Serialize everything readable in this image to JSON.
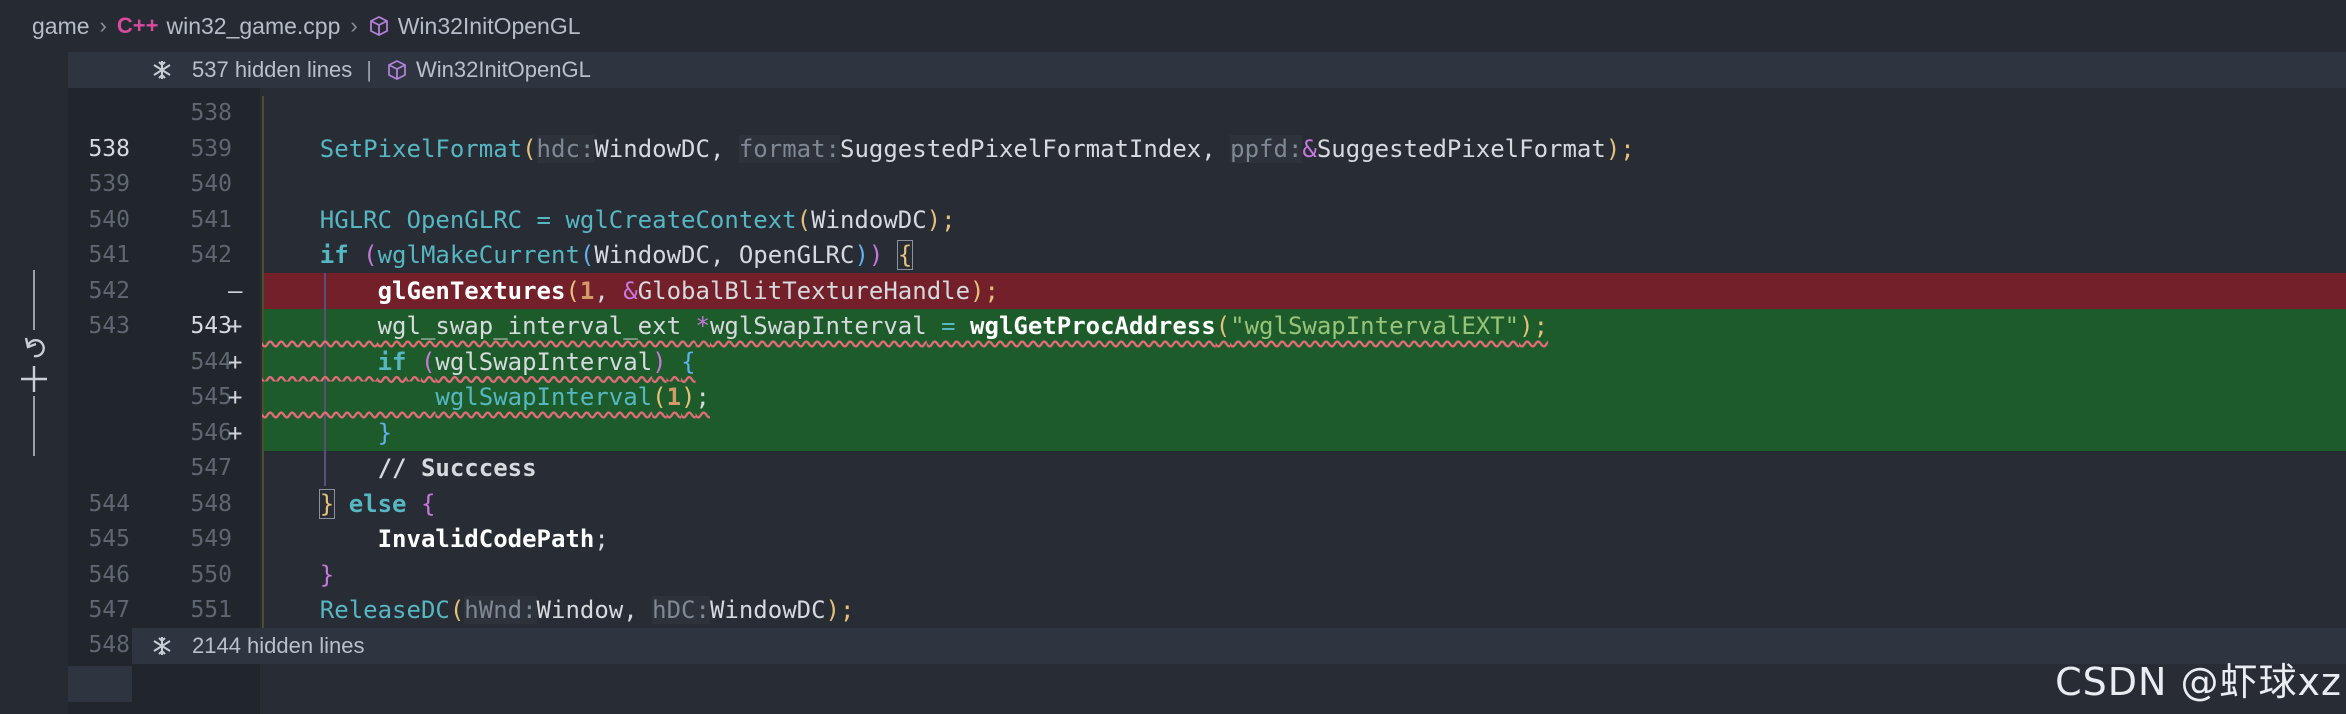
{
  "breadcrumb": {
    "folder": "game",
    "file_icon": "C++",
    "file": "win32_game.cpp",
    "symbol": "Win32InitOpenGL"
  },
  "fold_top": {
    "hidden": "537 hidden lines",
    "separator": "|",
    "symbol": "Win32InitOpenGL"
  },
  "fold_bottom": {
    "old_line": "548",
    "hidden": "2144 hidden lines"
  },
  "lines": [
    {
      "old": "",
      "new": "538",
      "sign": ""
    },
    {
      "old": "538",
      "new": "539",
      "sign": ""
    },
    {
      "old": "539",
      "new": "540",
      "sign": ""
    },
    {
      "old": "540",
      "new": "541",
      "sign": ""
    },
    {
      "old": "541",
      "new": "542",
      "sign": ""
    },
    {
      "old": "542",
      "new": "",
      "sign": "—"
    },
    {
      "old": "543",
      "new": "543",
      "sign": "+"
    },
    {
      "old": "",
      "new": "544",
      "sign": "+"
    },
    {
      "old": "",
      "new": "545",
      "sign": "+"
    },
    {
      "old": "",
      "new": "546",
      "sign": "+"
    },
    {
      "old": "",
      "new": "547",
      "sign": ""
    },
    {
      "old": "544",
      "new": "548",
      "sign": ""
    },
    {
      "old": "545",
      "new": "549",
      "sign": ""
    },
    {
      "old": "546",
      "new": "550",
      "sign": ""
    },
    {
      "old": "547",
      "new": "551",
      "sign": ""
    }
  ],
  "code": {
    "l539": {
      "fn": "SetPixelFormat",
      "h1": "hdc:",
      "a1": "WindowDC,",
      "h2": "format:",
      "a2": "SuggestedPixelFormatIndex,",
      "h3": "ppfd:",
      "a3": "SuggestedPixelFormat",
      "end": ");"
    },
    "l541": {
      "type": "HGLRC OpenGLRC = ",
      "fn": "wglCreateContext",
      "args": "WindowDC",
      "end": ");"
    },
    "l542": {
      "kw": "if",
      "fn": "wglMakeCurrent",
      "args": "WindowDC, OpenGLRC",
      "end": "{"
    },
    "l542del": {
      "fn": "glGenTextures",
      "num": "1",
      "rest": "GlobalBlitTextureHandle",
      "end": ");"
    },
    "l543": {
      "type": "wgl_swap_interval_ext ",
      "var": "wglSwapInterval",
      "eq": " = ",
      "fn": "wglGetProcAddress",
      "str": "\"wglSwapIntervalEXT\"",
      "end": ");"
    },
    "l544": {
      "kw": "if",
      "args": "wglSwapInterval",
      "end": "{"
    },
    "l545": {
      "fn": "wglSwapInterval",
      "num": "1",
      "end": ";"
    },
    "l546": {
      "brace": "}"
    },
    "l547": {
      "comment": "// Succcess"
    },
    "l548": {
      "else": "else",
      "brace": "{"
    },
    "l549": {
      "fn": "InvalidCodePath",
      "end": ";"
    },
    "l550": {
      "brace": "}"
    },
    "l551": {
      "fn": "ReleaseDC",
      "h1": "hWnd:",
      "a1": "Window,",
      "h2": "hDC:",
      "a2": "WindowDC",
      "end": ");"
    }
  },
  "watermark": "CSDN @虾球xz"
}
